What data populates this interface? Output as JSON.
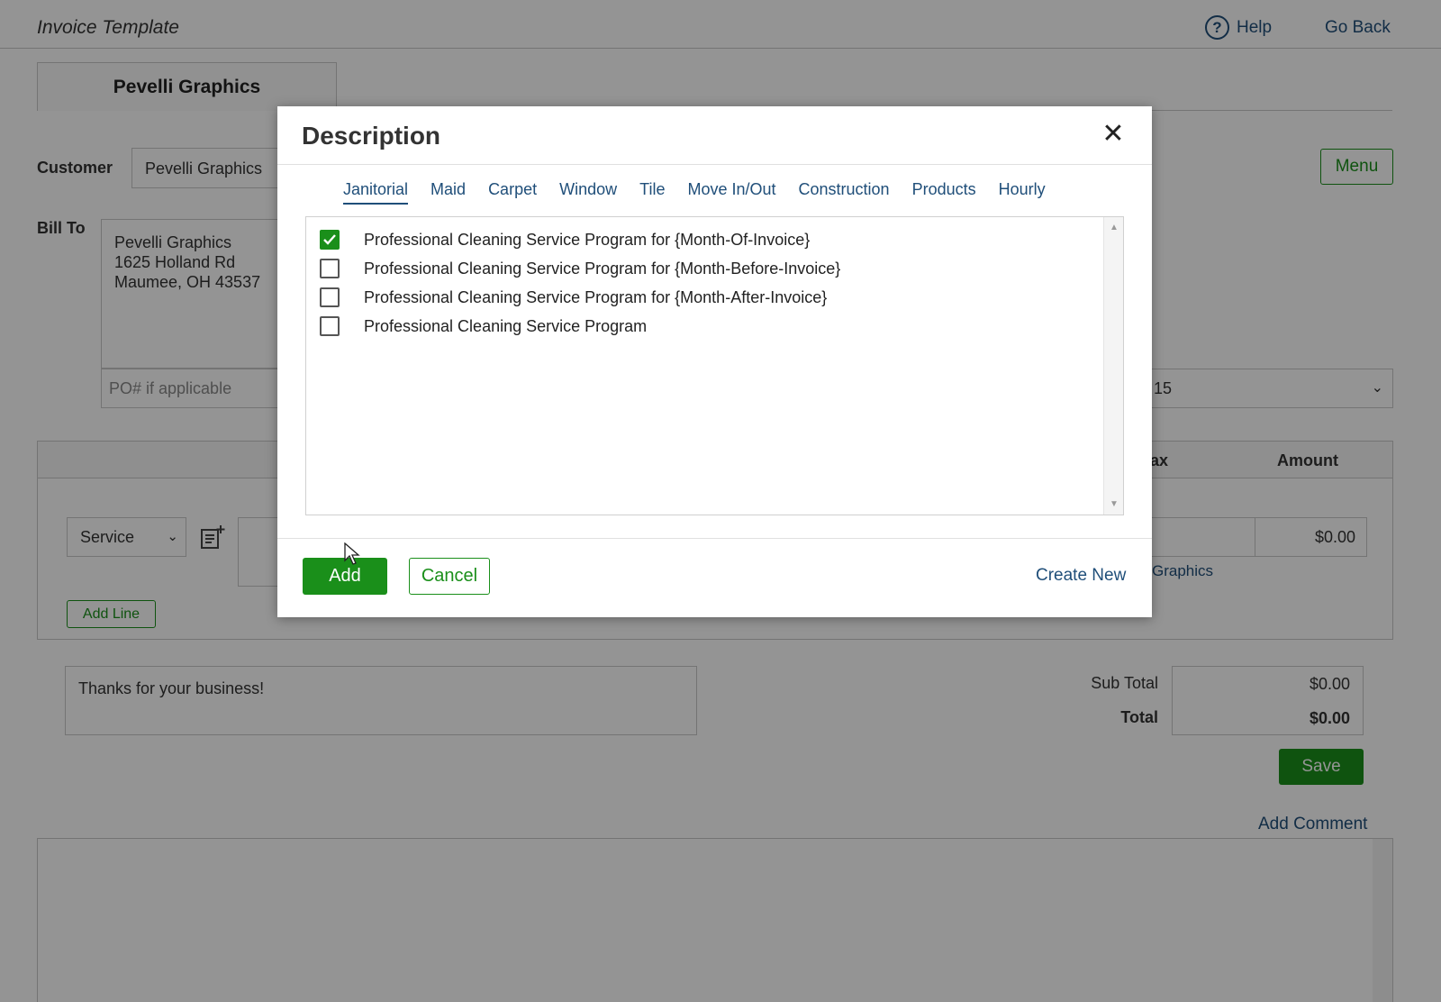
{
  "header": {
    "title": "Invoice Template",
    "help_label": "Help",
    "go_back_label": "Go Back"
  },
  "company_tab": "Pevelli Graphics",
  "form": {
    "customer_label": "Customer",
    "customer_value": "Pevelli Graphics",
    "bill_to_label": "Bill To",
    "bill_to_lines": [
      "Pevelli Graphics",
      "1625 Holland Rd",
      "Maumee, OH 43537"
    ],
    "po_placeholder": "PO# if applicable",
    "terms_value_partial": "15",
    "menu_label": "Menu"
  },
  "lines": {
    "header_tax_partial": "ax",
    "header_amount": "Amount",
    "type_select_value": "Service",
    "amount_value": "$0.00",
    "class_link_partial": "Graphics",
    "add_line_label": "Add Line"
  },
  "notes": {
    "message": "Thanks for your business!"
  },
  "totals": {
    "sub_total_label": "Sub Total",
    "sub_total_value": "$0.00",
    "total_label": "Total",
    "total_value": "$0.00"
  },
  "actions": {
    "save_label": "Save",
    "add_comment_label": "Add Comment"
  },
  "modal": {
    "title": "Description",
    "close_symbol": "✕",
    "tabs": [
      {
        "label": "Janitorial",
        "active": true
      },
      {
        "label": "Maid",
        "active": false
      },
      {
        "label": "Carpet",
        "active": false
      },
      {
        "label": "Window",
        "active": false
      },
      {
        "label": "Tile",
        "active": false
      },
      {
        "label": "Move In/Out",
        "active": false
      },
      {
        "label": "Construction",
        "active": false
      },
      {
        "label": "Products",
        "active": false
      },
      {
        "label": "Hourly",
        "active": false
      }
    ],
    "items": [
      {
        "label": "Professional Cleaning Service Program for {Month-Of-Invoice}",
        "checked": true
      },
      {
        "label": "Professional Cleaning Service Program for {Month-Before-Invoice}",
        "checked": false
      },
      {
        "label": "Professional Cleaning Service Program for {Month-After-Invoice}",
        "checked": false
      },
      {
        "label": "Professional Cleaning Service Program",
        "checked": false
      }
    ],
    "add_label": "Add",
    "cancel_label": "Cancel",
    "create_new_label": "Create New"
  },
  "colors": {
    "accent_green": "#1a8f1a",
    "link_blue": "#1f4e79"
  }
}
